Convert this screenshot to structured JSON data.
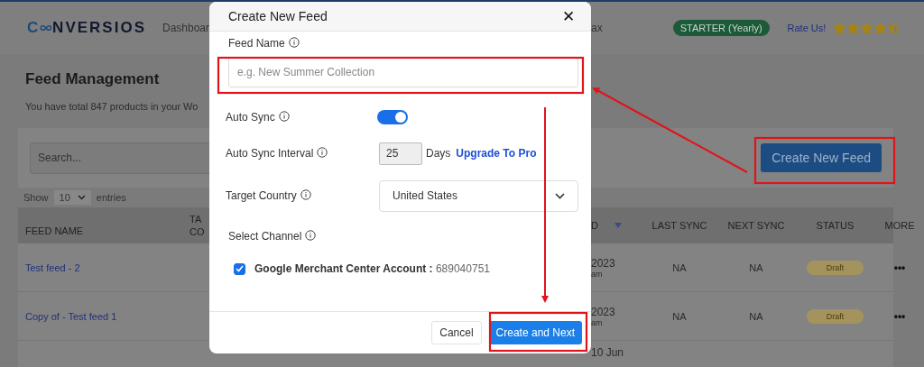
{
  "header": {
    "logo_prefix": "C",
    "logo_suffix": "NVERSIOS",
    "nav": [
      "Dashboar",
      "ax"
    ],
    "plan_badge": "STARTER (Yearly)",
    "rate_link": "Rate Us!",
    "stars": 4.5
  },
  "page": {
    "title": "Feed Management",
    "subtitle": "You have total 847 products in your Wo",
    "search_placeholder": "Search...",
    "create_button": "Create New Feed",
    "show_label": "Show",
    "page_size": "10",
    "entries_label": "entries"
  },
  "table": {
    "columns_left": [
      "FEED NAME",
      "TA CO"
    ],
    "columns_right": [
      "D",
      "LAST SYNC",
      "NEXT SYNC",
      "STATUS",
      "MORE"
    ],
    "rows": [
      {
        "name": "Test feed - 2",
        "date": "2023",
        "time": "am",
        "last_sync": "NA",
        "next_sync": "NA",
        "status": "Draft",
        "more": "•••"
      },
      {
        "name": "Copy of - Test feed 1",
        "date": "2023",
        "time": "am",
        "last_sync": "NA",
        "next_sync": "NA",
        "status": "Draft",
        "more": "•••"
      },
      {
        "date": "10 Jun"
      }
    ]
  },
  "modal": {
    "title": "Create New Feed",
    "close": "✕",
    "feed_name_label": "Feed Name",
    "feed_name_placeholder": "e.g. New Summer Collection",
    "auto_sync": {
      "label": "Auto Sync",
      "on": true
    },
    "interval": {
      "label": "Auto Sync Interval",
      "value": "25",
      "unit": "Days",
      "upgrade_link": "Upgrade To Pro"
    },
    "country": {
      "label": "Target Country",
      "value": "United States"
    },
    "channel_label": "Select Channel",
    "channels": [
      {
        "text": "**Google Merchant Center Account :** 689040751",
        "checked": true
      }
    ],
    "cancel": "Cancel",
    "submit": "Create and Next"
  }
}
